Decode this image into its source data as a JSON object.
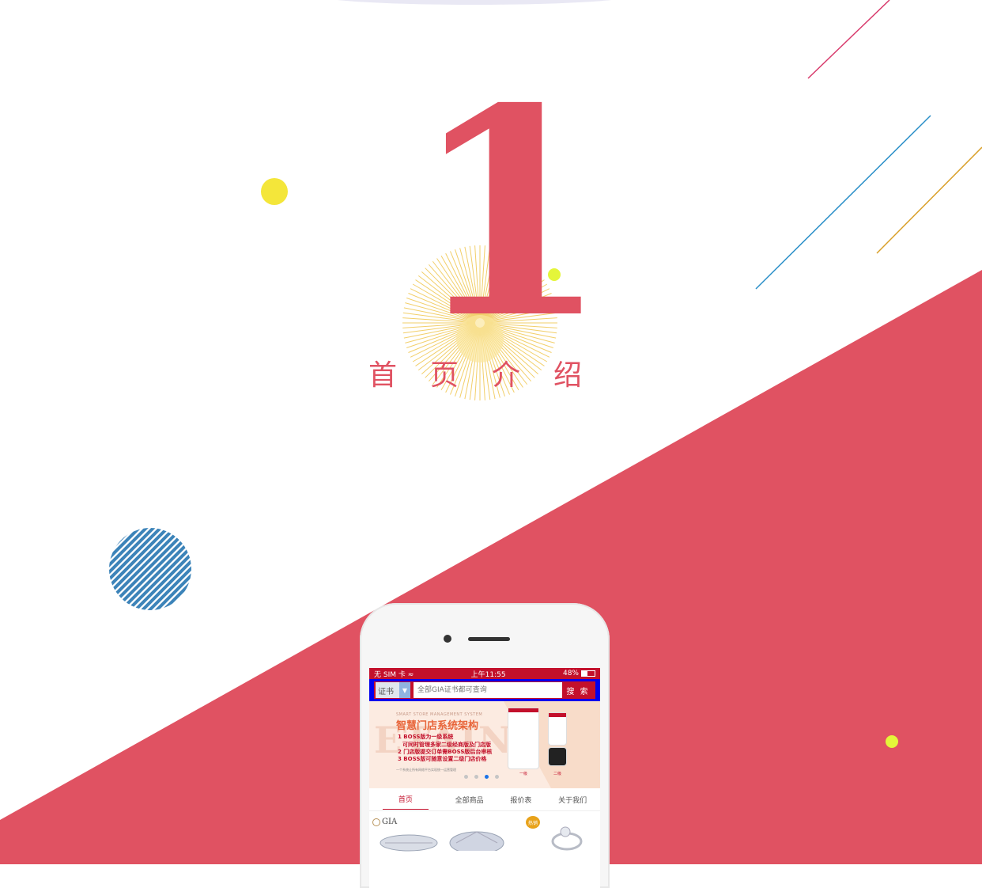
{
  "section": {
    "number": "1",
    "title_chars": [
      "首",
      "页",
      "介",
      "绍"
    ]
  },
  "colors": {
    "accent": "#e05262",
    "brand_red": "#c3102b",
    "yellow_dot": "#f4e63a",
    "lime_dot": "#e4f53a"
  },
  "phone": {
    "status": {
      "carrier": "无 SIM 卡 ",
      "wifi_icon": "wifi-icon",
      "time": "上午11:55",
      "battery": "48%"
    },
    "search": {
      "category": "证书",
      "placeholder": "全部GIA证书都可查询",
      "button": "搜 索"
    },
    "banner": {
      "watermark": "ETAIN",
      "subtitle": "SMART STORE MANAGEMENT SYSTEM",
      "title": "智慧门店系统架构",
      "lines": [
        "1 BOSS版为一级系统",
        "可同时管理多家二级经商版及门店版",
        "2 门店版提交订单需BOSS版后台审核",
        "3 BOSS版可随意设置二级门店价格"
      ],
      "footer": "一个系统让所有网络平台实现统一运营管理",
      "label_level1": "一级",
      "label_level2": "二级",
      "slide_count": 4,
      "active_slide": 3
    },
    "tabs": [
      "首页",
      "全部商品",
      "报价表",
      "关于我们"
    ],
    "active_tab": 0,
    "products": {
      "brand": "GIA",
      "badge": "热销"
    }
  }
}
